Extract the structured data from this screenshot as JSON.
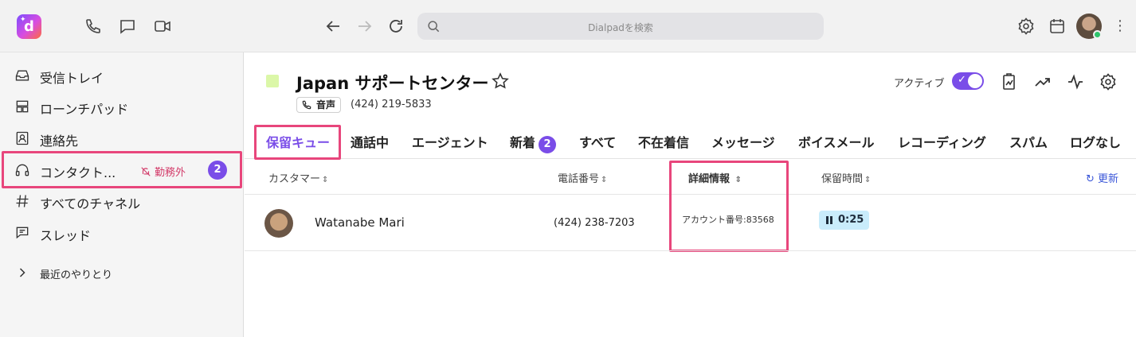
{
  "topbar": {
    "search_placeholder": "Dialpadを検索",
    "icons": [
      "phone-icon",
      "chat-icon",
      "video-icon",
      "back-icon",
      "forward-icon",
      "reload-icon",
      "settings-icon",
      "calendar-icon"
    ]
  },
  "sidebar": {
    "items": [
      {
        "label": "受信トレイ",
        "icon": "inbox-icon"
      },
      {
        "label": "ローンチパッド",
        "icon": "launchpad-icon"
      },
      {
        "label": "連絡先",
        "icon": "contacts-icon"
      },
      {
        "label": "コンタクト...",
        "icon": "headset-icon",
        "status": "勤務外",
        "badge": "2"
      },
      {
        "label": "すべてのチャネル",
        "icon": "hash-icon"
      },
      {
        "label": "スレッド",
        "icon": "thread-icon"
      },
      {
        "label": "最近のやりとり",
        "icon": "chevron-right-icon"
      }
    ]
  },
  "header": {
    "title": "Japan サポートセンター",
    "phone_tag": "音声",
    "phone_number": "(424) 219-5833",
    "active_label": "アクティブ",
    "active_toggle": true
  },
  "tabs": [
    {
      "label": "保留キュー",
      "active": true
    },
    {
      "label": "通話中"
    },
    {
      "label": "エージェント"
    },
    {
      "label": "新着",
      "badge": "2"
    },
    {
      "label": "すべて"
    },
    {
      "label": "不在着信"
    },
    {
      "label": "メッセージ"
    },
    {
      "label": "ボイスメール"
    },
    {
      "label": "レコーディング"
    },
    {
      "label": "スパム"
    },
    {
      "label": "ログなし"
    }
  ],
  "table": {
    "columns": {
      "customer": "カスタマー",
      "phone": "電話番号",
      "details": "詳細情報",
      "hold_time": "保留時間"
    },
    "refresh_label": "更新",
    "rows": [
      {
        "name": "Watanabe Mari",
        "phone": "(424) 238-7203",
        "details": "アカウント番号:83568",
        "hold_time": "0:25"
      }
    ]
  },
  "colors": {
    "accent": "#7a4de8",
    "highlight": "#e8467c",
    "hold_badge": "#c9ecfb",
    "queue_square": "#dbf7a8"
  }
}
